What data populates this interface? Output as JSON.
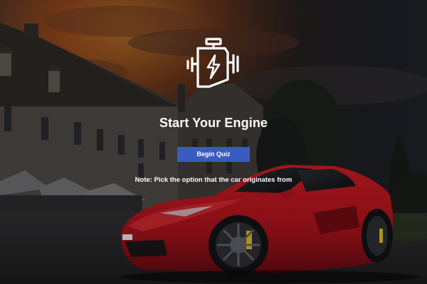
{
  "hero": {
    "icon": "engine-icon",
    "title": "Start Your Engine",
    "button_label": "Begin Quiz",
    "note": "Note: Pick the option that the car originates from"
  },
  "colors": {
    "button_bg": "#3a5bbf",
    "text": "#ffffff",
    "car_red": "#b8141c",
    "sky_orange": "#c8601f"
  }
}
